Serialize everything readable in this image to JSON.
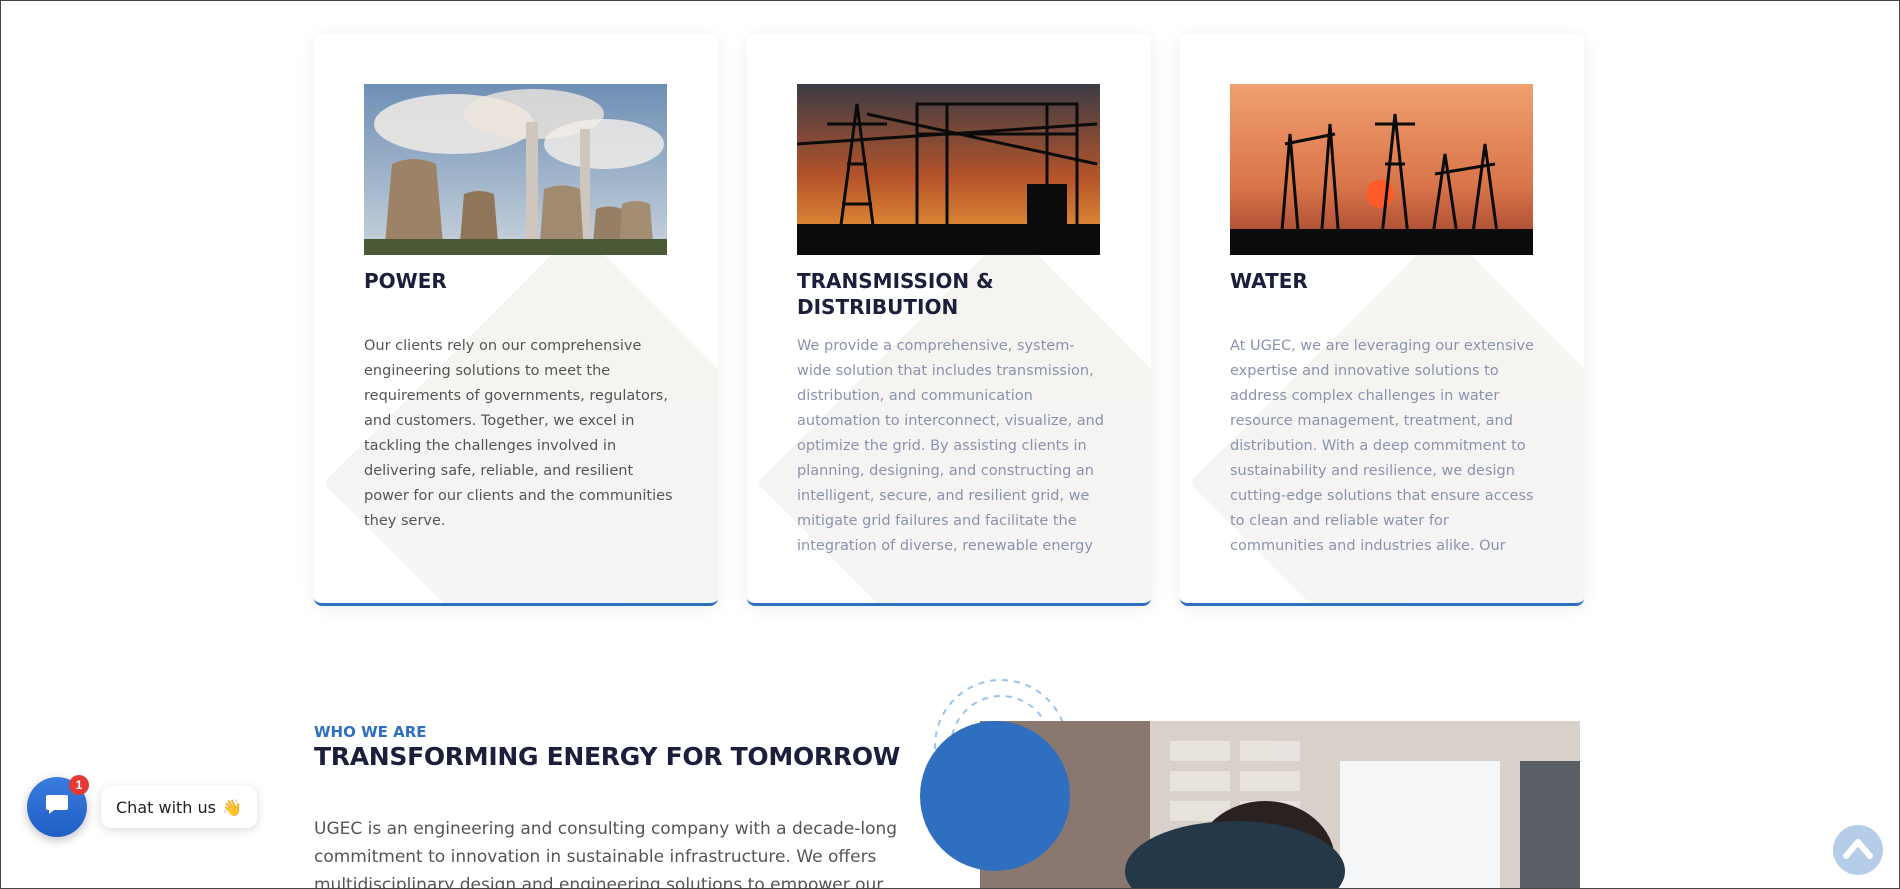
{
  "services": [
    {
      "title": "POWER",
      "body": "Our clients rely on our comprehensive engineering solutions to meet the requirements of governments, regulators, and customers. Together, we excel in tackling the challenges involved in delivering safe, reliable, and resilient power for our clients and the communities they serve."
    },
    {
      "title": "TRANSMISSION & DISTRIBUTION",
      "body": "We provide a comprehensive, system-wide solution that includes transmission, distribution, and communication automation to interconnect, visualize, and optimize the grid. By assisting clients in planning, designing, and constructing an intelligent, secure, and resilient grid, we mitigate grid failures and facilitate the integration of diverse, renewable energy"
    },
    {
      "title": "WATER",
      "body": "At UGEC, we are leveraging our extensive expertise and innovative solutions to address complex challenges in water resource management, treatment, and distribution. With a deep commitment to sustainability and resilience, we design cutting-edge solutions that ensure access to clean and reliable water for communities and industries alike. Our"
    }
  ],
  "about": {
    "tag": "WHO WE ARE",
    "title": "TRANSFORMING ENERGY FOR TOMORROW",
    "body": "UGEC is an engineering and consulting company with a decade-long commitment to innovation in sustainable infrastructure. We offers multidisciplinary design and engineering solutions to empower our clients"
  },
  "chat": {
    "label": "Chat with us",
    "emoji": "👋",
    "badge": "1"
  },
  "colors": {
    "accent": "#2f6fbf",
    "heading": "#1b1f3b",
    "badge": "#e53935"
  },
  "icons": {
    "chat": "chat-bubble-icon",
    "scroll_top": "chevron-up-icon"
  }
}
